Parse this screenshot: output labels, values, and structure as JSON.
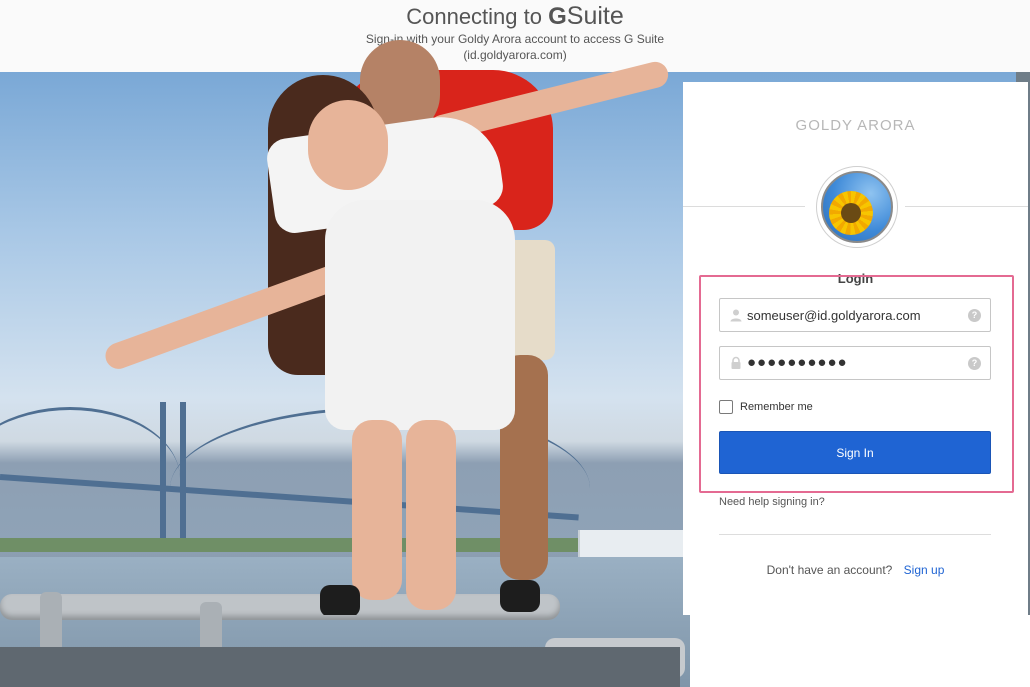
{
  "header": {
    "title_prefix": "Connecting to",
    "title_g": "G",
    "title_suite": "Suite",
    "subtitle": "Sign-in with your Goldy Arora account to access G Suite",
    "domain": "(id.goldyarora.com)"
  },
  "card": {
    "brand": "GOLDY ARORA",
    "login_heading": "Login",
    "username_value": "someuser@id.goldyarora.com",
    "password_value": "●●●●●●●●●●",
    "help_glyph": "?",
    "remember_label": "Remember me",
    "signin_label": "Sign In",
    "help_link": "Need help signing in?",
    "no_account_text": "Don't have an account?",
    "signup_link": "Sign up"
  },
  "icons": {
    "user": "user-icon",
    "lock": "lock-icon",
    "help": "help-icon",
    "avatar": "sunflower-avatar"
  },
  "colors": {
    "primary": "#1f64d3",
    "highlight": "#e46a92"
  }
}
